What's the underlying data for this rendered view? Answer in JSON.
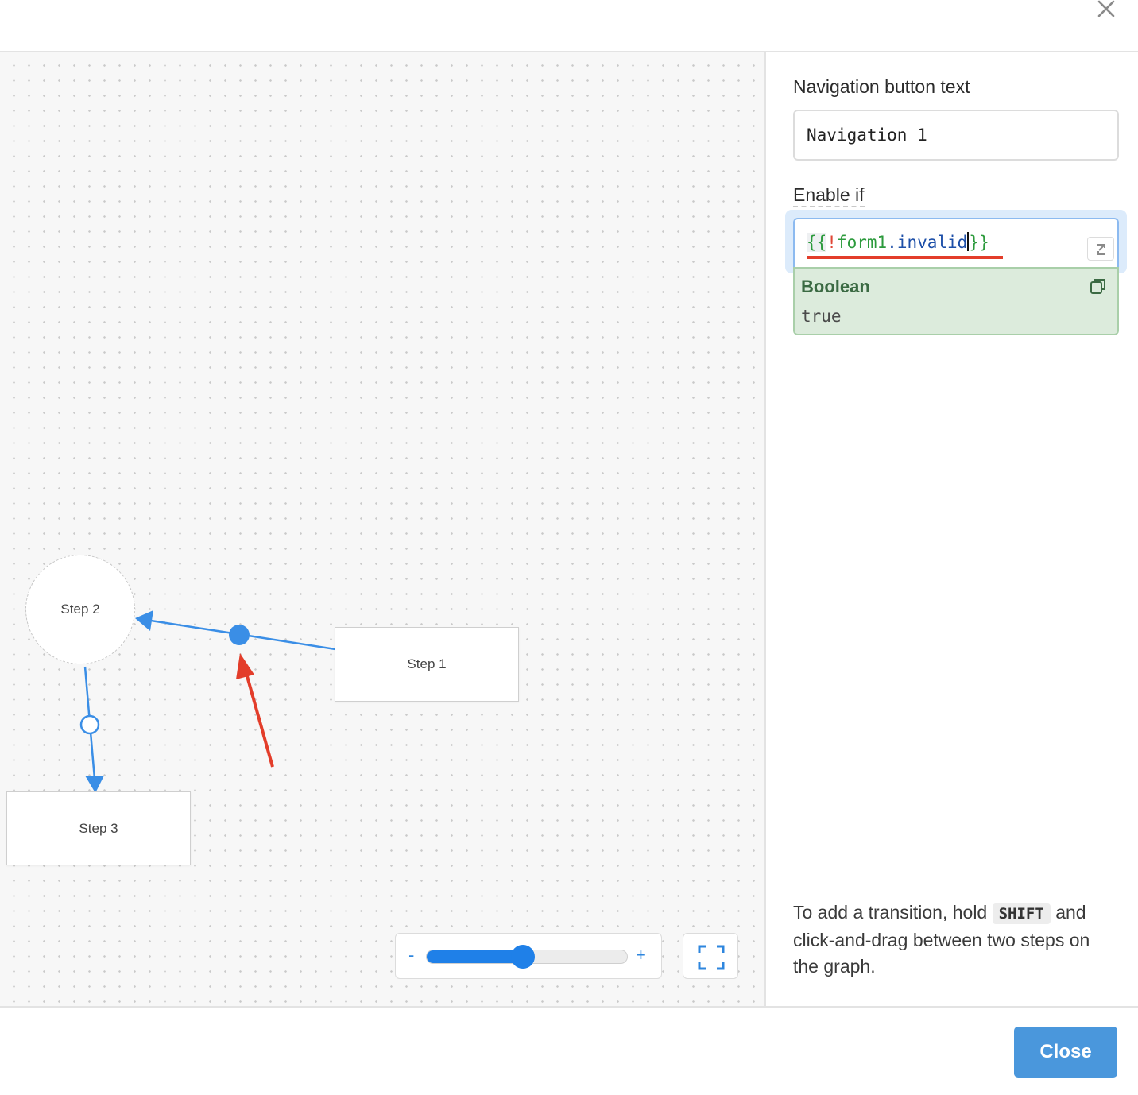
{
  "graph": {
    "steps": [
      {
        "id": "step1",
        "label": "Step 1",
        "shape": "rect"
      },
      {
        "id": "step2",
        "label": "Step 2",
        "shape": "circle",
        "state": "dashed"
      },
      {
        "id": "step3",
        "label": "Step 3",
        "shape": "rect"
      }
    ],
    "transitions": [
      {
        "from": "Step 1",
        "to": "Step 2",
        "selected": true
      },
      {
        "from": "Step 2",
        "to": "Step 3",
        "selected": false
      }
    ],
    "zoom": {
      "minus_label": "-",
      "plus_label": "+",
      "level_fraction": 0.44
    },
    "colors": {
      "edge": "#3a8ee6",
      "annotation": "#e33d2a"
    }
  },
  "panel": {
    "nav_label": "Navigation button text",
    "nav_value": "Navigation 1",
    "enable_label": "Enable if",
    "code": {
      "brace_open": "{{",
      "bang": "!",
      "ident": "form1",
      "dot": ".",
      "prop": "invalid",
      "brace_close": "}}"
    },
    "result": {
      "type": "Boolean",
      "value": "true"
    },
    "hint_prefix": "To add a transition, hold",
    "hint_key": "SHIFT",
    "hint_suffix": "and click-and-drag between two steps on the graph."
  },
  "footer": {
    "close_label": "Close"
  }
}
